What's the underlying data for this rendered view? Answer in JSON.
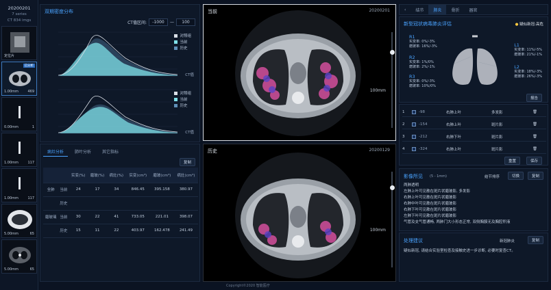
{
  "series_panel": {
    "date": "20200201",
    "series_count": "7 series",
    "image_count": "CT 834 imgs",
    "thumbs": [
      {
        "label": "定位片",
        "count": "",
        "tag": ""
      },
      {
        "label": "1.00mm",
        "count": "469",
        "tag": "已分析"
      },
      {
        "label": "0.00mm",
        "count": "1",
        "tag": ""
      },
      {
        "label": "1.00mm",
        "count": "117",
        "tag": ""
      },
      {
        "label": "1.00mm",
        "count": "117",
        "tag": ""
      },
      {
        "label": "5.00mm",
        "count": "65",
        "tag": ""
      },
      {
        "label": "5.00mm",
        "count": "65",
        "tag": ""
      }
    ]
  },
  "density": {
    "title": "双期密度分布",
    "ct_range_label": "CT值区间:",
    "ct_min": "-1000",
    "ct_max": "100",
    "axis_label": "CT值",
    "legend": [
      "对照组",
      "当前",
      "历史"
    ],
    "colors": {
      "control": "#d9dee6",
      "current": "#7fe0e8",
      "history": "#5f8fb8"
    }
  },
  "analysis": {
    "tabs": [
      "病灶分析",
      "肺叶分析",
      "其它指标"
    ],
    "copy_label": "复制",
    "headers": [
      "",
      "",
      "实变(%)",
      "磨玻(%)",
      "病灶(%)",
      "实变(cm³)",
      "磨玻(cm³)",
      "病灶(cm³)"
    ],
    "rows": [
      {
        "group": "全肺",
        "sub": "当前",
        "cells": [
          "24",
          "17",
          "34",
          "846.45",
          "395.158",
          "380.97"
        ]
      },
      {
        "group": "",
        "sub": "历史",
        "cells": [
          "",
          "",
          "",
          "",
          "",
          ""
        ]
      },
      {
        "group": "磨玻璃",
        "sub": "当前",
        "cells": [
          "30",
          "22",
          "41",
          "733.05",
          "221.01",
          "398.07"
        ]
      },
      {
        "group": "",
        "sub": "历史",
        "cells": [
          "15",
          "11",
          "22",
          "403.97",
          "162.478",
          "241.49"
        ]
      }
    ]
  },
  "viewers": {
    "current": {
      "title": "当前",
      "date": "20200201",
      "scale": "100mm"
    },
    "history": {
      "title": "历史",
      "date": "20200129",
      "scale": "100mm"
    }
  },
  "right_tabs": [
    "结节",
    "肺炎",
    "骨折",
    "器官"
  ],
  "risk": {
    "title": "新型冠状病毒肺炎评估",
    "badge": "疑似新冠:高危",
    "lobes": [
      {
        "name": "R1",
        "l1": "实变率: 0%/-3%",
        "l2": "磨玻率: 16%/-3%"
      },
      {
        "name": "R2",
        "l1": "实变率: 1%/0%",
        "l2": "磨玻率: 2%/-1%"
      },
      {
        "name": "R3",
        "l1": "实变率: 0%/-3%",
        "l2": "磨玻率: 10%/0%"
      },
      {
        "name": "L1",
        "l1": "实变率: 11%/-5%",
        "l2": "磨玻率: 21%/-1%"
      },
      {
        "name": "L2",
        "l1": "实变率: 18%/-3%",
        "l2": "磨玻率: 26%/-3%"
      }
    ],
    "report_btn": "报告"
  },
  "lesions": {
    "rows": [
      {
        "idx": "1",
        "hu": "-98",
        "loc": "右肺上叶",
        "type": "多发影"
      },
      {
        "idx": "2",
        "hu": "-154",
        "loc": "右肺上叶",
        "type": "斑片影"
      },
      {
        "idx": "3",
        "hu": "-212",
        "loc": "右肺下叶",
        "type": "斑片影"
      },
      {
        "idx": "4",
        "hu": "-324",
        "loc": "右肺上叶",
        "type": "斑片影"
      }
    ],
    "reset_btn": "重置",
    "save_btn": "保存"
  },
  "findings": {
    "title": "影像所见",
    "subtitle": "(5 - 1mm)",
    "sort_label": "结节排序",
    "toggle_label": "切换",
    "copy_label": "复制",
    "lines": [
      "两肺透明",
      "左肺上叶可见散在斑片状磨玻影, 多发影",
      "右肺上叶可见散在斑片状磨玻影",
      "右肺中叶可见散在斑片状磨玻影",
      "右肺下叶可见散在斑片状磨玻影",
      "左肺下叶可见散在斑片状磨玻影",
      "气管及支气管通畅, 两肺门大小形态正常, 双侧胸膜无及胸腔积液"
    ]
  },
  "advice": {
    "title": "处理建议",
    "sort_label": "新冠肺炎",
    "copy_label": "复制",
    "lines": [
      "疑似新冠, 请结合实验室检查及接触史进一步诊断, 必要时复查CT。"
    ]
  },
  "copyright": "Copyright©2020 智能医疗"
}
